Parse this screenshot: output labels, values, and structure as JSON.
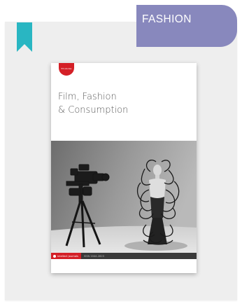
{
  "category": {
    "label": "FASHION",
    "color": "#8888bd"
  },
  "bookmark": {
    "icon": "bookmark-icon",
    "color": "#29b6c2"
  },
  "cover": {
    "badge": "film studies",
    "title_line1": "Film, Fashion",
    "title_line2": "& Consumption",
    "footer_brand": "intellect journals",
    "footer_issn": "ISSN 2044-2823",
    "accent_color": "#d42027"
  }
}
